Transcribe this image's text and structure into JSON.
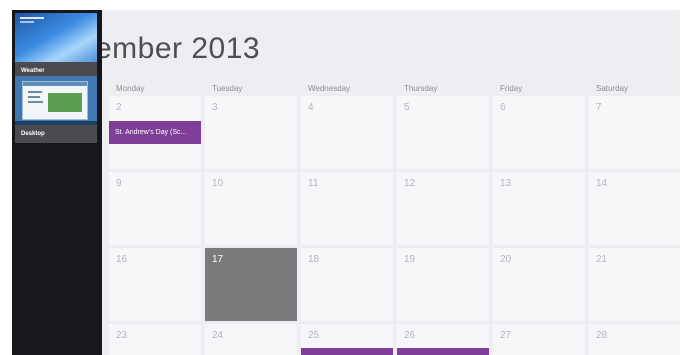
{
  "switcher": {
    "apps": [
      {
        "label": "Weather"
      },
      {
        "label": "Desktop"
      }
    ]
  },
  "calendar": {
    "month_title": "ember 2013",
    "day_names": [
      "Monday",
      "Tuesday",
      "Wednesday",
      "Thursday",
      "Friday",
      "Saturday"
    ],
    "rows": [
      [
        "2",
        "3",
        "4",
        "5",
        "6",
        "7"
      ],
      [
        "9",
        "10",
        "11",
        "12",
        "13",
        "14"
      ],
      [
        "16",
        "17",
        "18",
        "19",
        "20",
        "21"
      ],
      [
        "23",
        "24",
        "25",
        "26",
        "27",
        "28"
      ]
    ],
    "today": "17",
    "events": [
      {
        "label": "St. Andrew's Day (Sc..."
      },
      {
        "label": ""
      },
      {
        "label": ""
      }
    ]
  },
  "colors": {
    "event": "#7f3f99",
    "today": "#7a7a7c",
    "switcher_bg": "#17171b"
  }
}
